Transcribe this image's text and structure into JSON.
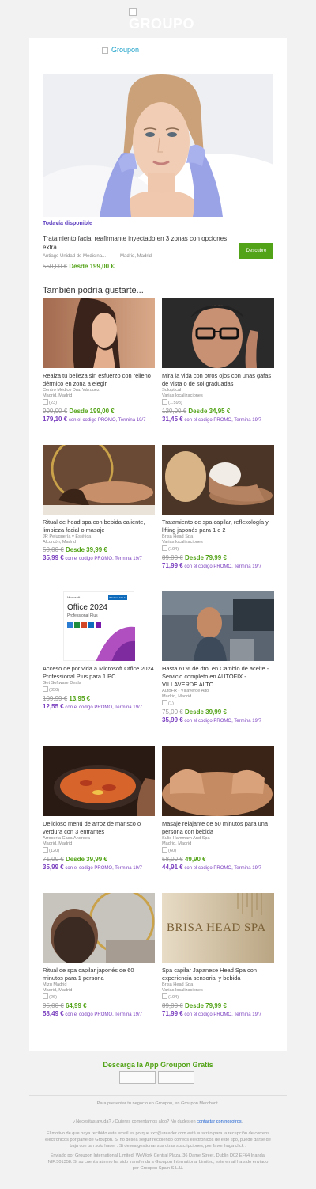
{
  "brand": {
    "logo_text": "GROUPO",
    "header_logo_alt": "Groupon"
  },
  "hero": {
    "availability": "Todavía disponible",
    "title": "Tratamiento facial reafirmante inyectado en 3 zonas con opciones extra",
    "merchant": "Antiage Unidad de Medicina...",
    "location": "Madrid, Madrid",
    "old_price": "550,00 €",
    "new_price": "Desde 199,00 €",
    "button": "Descubre"
  },
  "also_title": "También podría gustarte...",
  "deals": [
    {
      "title": "Realza tu belleza sin esfuerzo con relleno dérmico en zona a elegir",
      "meta": [
        "Centro Médico Dra. Vázquez",
        "Madrid, Madrid"
      ],
      "rating": "(23)",
      "old_price": "900,00 €",
      "new_price": "Desde 199,00 €",
      "promo_price": "179,10 €",
      "promo_text": "con el codigo PROMO, Termina 19/7"
    },
    {
      "title": "Mira la vida con otros ojos con unas gafas de vista o de sol graduadas",
      "meta": [
        "Soloptical",
        "Varias localizaciones"
      ],
      "rating": "(1.598)",
      "old_price": "120,00 €",
      "new_price": "Desde 34,95 €",
      "promo_price": "31,45 €",
      "promo_text": "con el codigo PROMO, Termina 19/7"
    },
    {
      "title": "Ritual de head spa con bebida caliente, limpieza facial o masaje",
      "meta": [
        "JR Peluquería y Estética",
        "Alcorcón, Madrid"
      ],
      "rating": "",
      "old_price": "50,00 €",
      "new_price": "Desde 39,99 €",
      "promo_price": "35,99 €",
      "promo_text": "con el codigo PROMO, Termina 19/7"
    },
    {
      "title": "Tratamiento de spa capilar, reflexología y lifting japonés para 1 o 2",
      "meta": [
        "Brisa Head Spa",
        "Varias localizaciones"
      ],
      "rating": "(104)",
      "old_price": "89,00 €",
      "new_price": "Desde 79,99 €",
      "promo_price": "71,99 €",
      "promo_text": "con el codigo PROMO, Termina 19/7"
    },
    {
      "title": "Acceso de por vida a Microsoft Office 2024 Professional Plus para 1 PC",
      "meta": [
        "Get Software Deals"
      ],
      "rating": "(350)",
      "old_price": "109,99 €",
      "new_price": "13,95 €",
      "promo_price": "12,55 €",
      "promo_text": "con el codigo PROMO, Termina 19/7"
    },
    {
      "title": "Hasta 61% de dto. en Cambio de aceite - Servicio completo en AUTOFIX - VILLAVERDE ALTO",
      "meta": [
        "AutoFix - Villaverde Alto",
        "Madrid, Madrid"
      ],
      "rating": "(1)",
      "old_price": "75,00 €",
      "new_price": "Desde 39,99 €",
      "promo_price": "35,99 €",
      "promo_text": "con el codigo PROMO, Termina 19/7"
    },
    {
      "title": "Delicioso menú de arroz de marisco o verdura con 3 entrantes",
      "meta": [
        "Arrocería Casa Andreea",
        "Madrid, Madrid"
      ],
      "rating": "(120)",
      "old_price": "71,00 €",
      "new_price": "Desde 39,99 €",
      "promo_price": "35,99 €",
      "promo_text": "con el codigo PROMO, Termina 19/7"
    },
    {
      "title": "Masaje relajante de 50 minutos para una persona con bebida",
      "meta": [
        "Sulis Hammam And Spa",
        "Madrid, Madrid"
      ],
      "rating": "(60)",
      "old_price": "58,00 €",
      "new_price": "49,90 €",
      "promo_price": "44,91 €",
      "promo_text": "con el codigo PROMO, Termina 19/7"
    },
    {
      "title": "Ritual de spa capilar japonés de 60 minutos para 1 persona",
      "meta": [
        "Mizu Madrid",
        "Madrid, Madrid"
      ],
      "rating": "(26)",
      "old_price": "95,00 €",
      "new_price": "64,99 €",
      "promo_price": "58,49 €",
      "promo_text": "con el codigo PROMO, Termina 19/7"
    },
    {
      "title": "Spa capilar Japanese Head Spa con experiencia sensorial y bebida",
      "meta": [
        "Brisa Head Spa",
        "Varias localizaciones"
      ],
      "rating": "(104)",
      "old_price": "89,00 €",
      "new_price": "Desde 79,99 €",
      "promo_price": "71,99 €",
      "promo_text": "con el codigo PROMO, Termina 19/7"
    }
  ],
  "office_image": {
    "brand": "Microsoft",
    "product": "Office 2024",
    "edition": "Professional Plus",
    "tag": "Windows 10 / 11"
  },
  "spa_sign": "BRISA HEAD SPA",
  "footer": {
    "app_title": "Descarga la App Groupon Gratis",
    "merchant": "Para presentar tu negocio en Groupon, en Groupon Merchant.",
    "help_text": "¿Necesitas ayuda? ¿Quieres comentarnos algo? No dudes en",
    "help_link": "contactar con nosotros",
    "help_end": ".",
    "reason": "El motivo de que haya recibido este email es porque xxx@ureader.com está suscrito para la recepción de correos electrónicos por parte de Groupon. Si no desea seguir recibiendo correos electrónicos de este tipo, puede darse de baja con tan solo hacer . Si desea gestionar sus otras suscripciones, por favor haga click .",
    "legal": "Enviado por Groupon International Limited, WeWork Central Plaza, 36 Dame Street, Dublin D02 EF64 Irlanda, NIF:501358. Si su cuenta aún no ha sido transferida a Groupon International Limited, este email ha sido enviado por Groupon Spain S.L.U."
  }
}
